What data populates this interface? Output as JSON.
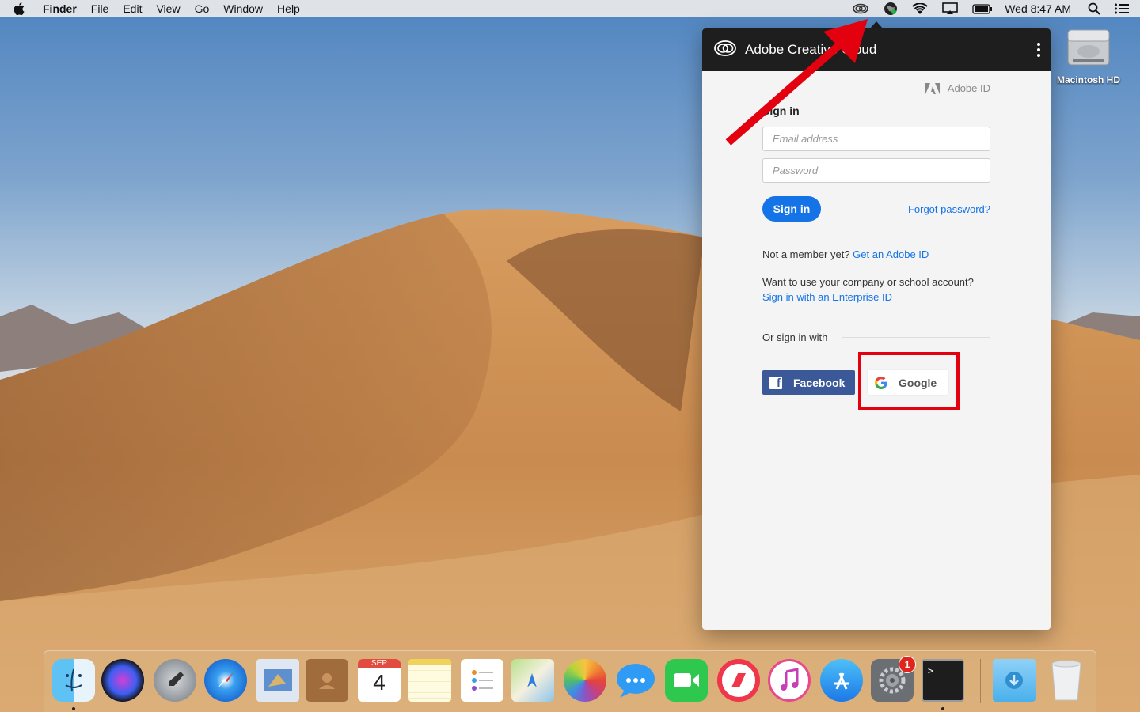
{
  "menubar": {
    "app_name": "Finder",
    "menus": [
      "File",
      "Edit",
      "View",
      "Go",
      "Window",
      "Help"
    ],
    "clock": "Wed 8:47 AM",
    "status_icons": [
      "creative-cloud-icon",
      "globe-icon",
      "wifi-icon",
      "airplay-icon",
      "battery-icon",
      "spotlight-icon",
      "notification-center-icon"
    ]
  },
  "desktop": {
    "drive_label": "Macintosh HD"
  },
  "cc_panel": {
    "title": "Adobe Creative Cloud",
    "adobe_id_label": "Adobe ID",
    "sign_in_heading": "Sign in",
    "email_placeholder": "Email address",
    "password_placeholder": "Password",
    "sign_in_button": "Sign in",
    "forgot_password": "Forgot password?",
    "not_member_text": "Not a member yet?",
    "get_adobe_id": "Get an Adobe ID",
    "company_text": "Want to use your company or school account?",
    "enterprise_link": "Sign in with an Enterprise ID",
    "or_sign_in_with": "Or sign in with",
    "facebook_button": "Facebook",
    "google_button": "Google",
    "colors": {
      "header": "#1e1e1e",
      "accent": "#1473e6",
      "facebook": "#3b5998",
      "annotation": "#e3000f"
    }
  },
  "dock": {
    "apps": [
      "Finder",
      "Siri",
      "Launchpad",
      "Safari",
      "Mail",
      "Contacts",
      "Calendar",
      "Notes",
      "Reminders",
      "Maps",
      "Photos",
      "Messages",
      "FaceTime",
      "News",
      "iTunes",
      "App Store",
      "System Preferences",
      "Terminal",
      "Downloads",
      "Trash"
    ],
    "calendar_month": "SEP",
    "calendar_day": "4",
    "system_prefs_badge": "1"
  }
}
